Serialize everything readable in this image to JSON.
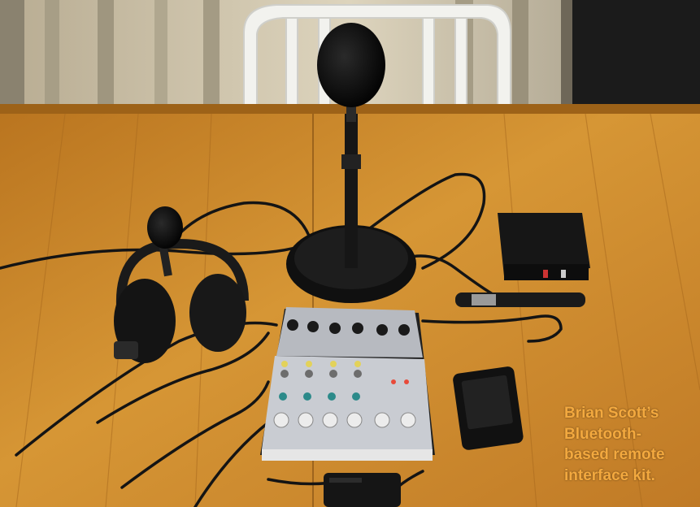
{
  "caption": {
    "lines": [
      "Brian Scott’s",
      "Bluetooth-",
      "based remote",
      "interface kit."
    ]
  },
  "colors": {
    "table_wood": "#c8862c",
    "caption_text": "#f3a93f",
    "mixer_panel": "#c9ccd2",
    "equipment_black": "#151515"
  },
  "objects": [
    "desk-microphone",
    "headset-with-boom-mic",
    "audio-mixer",
    "bluetooth-interface-box",
    "mobile-phone",
    "power-adapter",
    "cables"
  ]
}
